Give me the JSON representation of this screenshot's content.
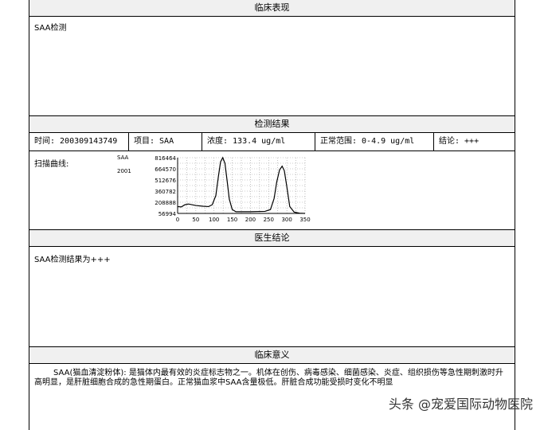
{
  "sections": {
    "clinical": "临床表现",
    "result": "检测结果",
    "conclusion": "医生结论",
    "meaning": "临床意义"
  },
  "clinical_text": "SAA检测",
  "result_row": {
    "time": "时间: 200309143749",
    "item": "项目: SAA",
    "conc": "浓度: 133.4 ug/ml",
    "range": "正常范围: 0-4.9 ug/ml",
    "verdict": "结论: +++"
  },
  "scan_label": "扫描曲线:",
  "chart_data": {
    "type": "line",
    "legend": [
      "SAA",
      "2001"
    ],
    "yticks": [
      "816464",
      "664570",
      "512676",
      "360782",
      "208888",
      "56994"
    ],
    "xticks": [
      "0",
      "50",
      "100",
      "150",
      "200",
      "250",
      "300",
      "350"
    ],
    "xlim": [
      0,
      350
    ],
    "ylim": [
      56994,
      816464
    ],
    "x": [
      0,
      10,
      20,
      30,
      50,
      70,
      85,
      95,
      105,
      112,
      118,
      124,
      130,
      136,
      142,
      150,
      160,
      200,
      240,
      255,
      265,
      272,
      280,
      287,
      293,
      300,
      308,
      320,
      335,
      350
    ],
    "y": [
      150000,
      145000,
      175000,
      185000,
      165000,
      155000,
      150000,
      175000,
      300000,
      560000,
      760000,
      816464,
      740000,
      500000,
      250000,
      110000,
      80000,
      80000,
      85000,
      110000,
      260000,
      480000,
      650000,
      700000,
      640000,
      420000,
      150000,
      75000,
      60000,
      56994
    ]
  },
  "conclusion_text": "SAA检测结果为+++",
  "meaning_text": "SAA(猫血清淀粉体): 是猫体内最有效的炎症标志物之一。机体在创伤、病毒感染、细菌感染、炎症、组织损伤等急性期刺激时升高明显，是肝脏细胞合成的急性期蛋白。正常猫血浆中SAA含量极低。肝脏合成功能受损时变化不明显",
  "watermark": "头条 @宠爱国际动物医院"
}
